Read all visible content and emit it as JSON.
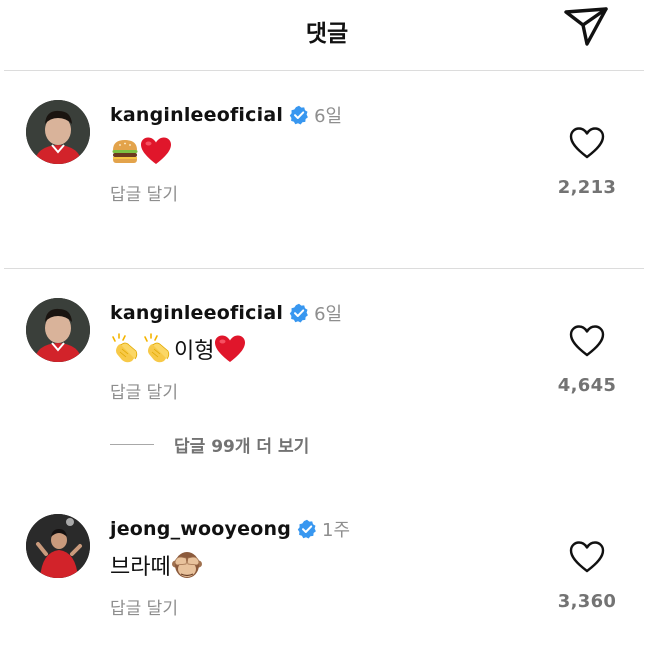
{
  "header": {
    "title": "댓글",
    "send_icon": "send-icon"
  },
  "comments": [
    {
      "username": "kanginleeoficial",
      "verified": true,
      "time": "6일",
      "text": "",
      "emojis": [
        "hamburger",
        "red-heart"
      ],
      "reply_label": "답글 달기",
      "like_count": "2,213"
    },
    {
      "username": "kanginleeoficial",
      "verified": true,
      "time": "6일",
      "text": "이형",
      "emojis": [
        "clapping-hands",
        "clapping-hands",
        "red-heart"
      ],
      "reply_label": "답글 달기",
      "like_count": "4,645",
      "view_replies": "답글 99개 더 보기"
    },
    {
      "username": "jeong_wooyeong",
      "verified": true,
      "time": "1주",
      "text": "브라떼",
      "emojis": [
        "see-no-evil-monkey"
      ],
      "reply_label": "답글 달기",
      "like_count": "3,360"
    }
  ],
  "colors": {
    "verified": "#3897f0",
    "muted": "#8e8e8e",
    "heart": "#e0162b"
  }
}
